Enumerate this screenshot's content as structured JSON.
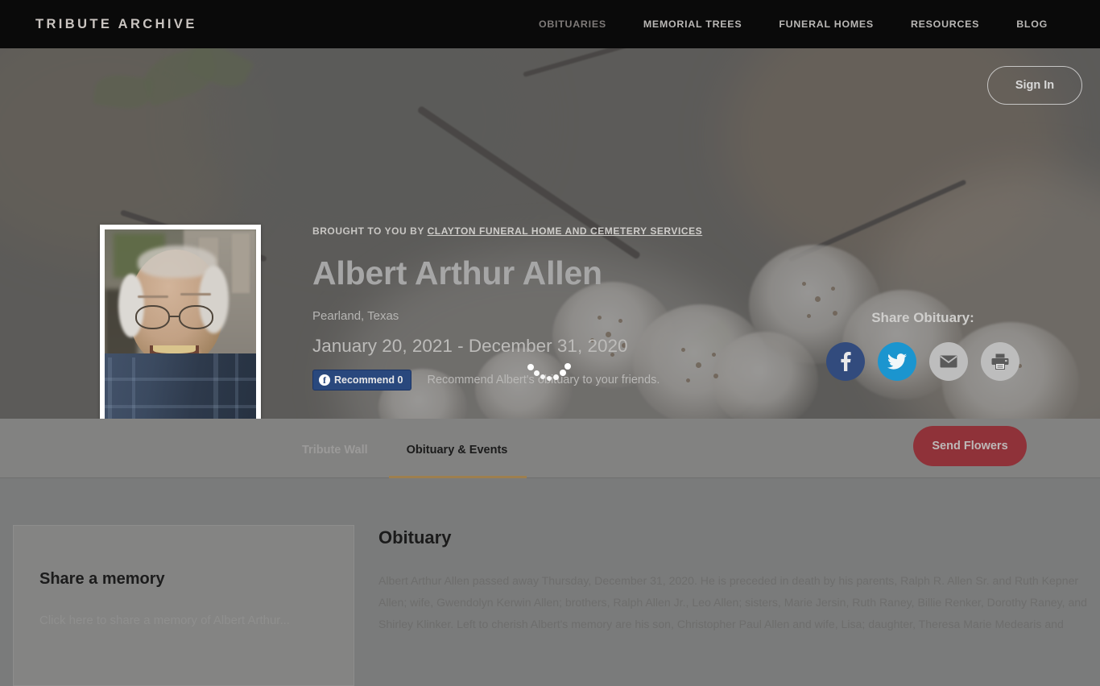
{
  "header": {
    "brand": "TRIBUTE ARCHIVE",
    "nav": [
      {
        "label": "OBITUARIES",
        "active": true
      },
      {
        "label": "MEMORIAL TREES",
        "active": false
      },
      {
        "label": "FUNERAL HOMES",
        "active": false
      },
      {
        "label": "RESOURCES",
        "active": false
      },
      {
        "label": "BLOG",
        "active": false
      }
    ],
    "sign_in": "Sign In"
  },
  "hero": {
    "brought_to_you_by_prefix": "BROUGHT TO YOU BY ",
    "funeral_home": "CLAYTON FUNERAL HOME AND CEMETERY SERVICES",
    "name": "Albert Arthur Allen",
    "location": "Pearland, Texas",
    "dates": "January 20, 2021 - December 31, 2020",
    "recommend_label": "Recommend",
    "recommend_count": "0",
    "recommend_hint": "Recommend Albert's obituary to your friends.",
    "share_title": "Share Obituary:",
    "share_buttons": [
      {
        "name": "facebook",
        "color": "#324b7d"
      },
      {
        "name": "twitter",
        "color": "#1b95cf"
      },
      {
        "name": "email",
        "color": "#bdbdbd"
      },
      {
        "name": "print",
        "color": "#bdbdbd"
      }
    ]
  },
  "tabbar": {
    "tabs": [
      {
        "label": "Tribute Wall",
        "active": false
      },
      {
        "label": "Obituary & Events",
        "active": true
      }
    ],
    "send_flowers": "Send Flowers",
    "active_underline_color": "#9d7f4e"
  },
  "sidebar": {
    "share_memory_title": "Share a memory",
    "share_memory_sub": "Click here to share a memory of Albert Arthur..."
  },
  "main": {
    "obituary_heading": "Obituary",
    "obituary_text": "Albert Arthur Allen passed away Thursday, December 31, 2020. He is preceded in death by his parents, Ralph R. Allen Sr. and Ruth Kepner Allen; wife, Gwendolyn Kerwin Allen; brothers, Ralph Allen Jr., Leo Allen; sisters, Marie Jersin, Ruth Raney, Billie Renker, Dorothy Raney, and Shirley Klinker. Left to cherish Albert's memory are his son, Christopher Paul Allen and wife, Lisa; daughter, Theresa Marie Medearis and"
  },
  "colors": {
    "overlay_gray": "#7a7b7b",
    "topbar_black": "#0a0a0a",
    "send_flowers_red": "#8f3239",
    "facebook_blue": "#29487d",
    "tab_gold": "#9d7f4e"
  }
}
